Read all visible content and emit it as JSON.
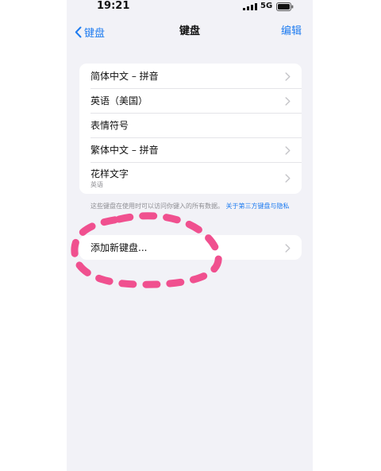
{
  "status_bar": {
    "time": "19:21",
    "network": "5G"
  },
  "nav": {
    "back_label": "键盘",
    "title": "键盘",
    "edit_label": "编辑"
  },
  "keyboards": [
    {
      "label": "简体中文 – 拼音"
    },
    {
      "label": "英语（美国）"
    },
    {
      "label": "表情符号"
    },
    {
      "label": "繁体中文 – 拼音"
    },
    {
      "label": "花样文字",
      "sub": "英语"
    }
  ],
  "footnote": {
    "text": "这些键盘在使用时可以访问你键入的所有数据。",
    "link": "关于第三方键盘与隐私"
  },
  "add_keyboard": {
    "label": "添加新键盘..."
  },
  "colors": {
    "accent": "#1f7cf0",
    "annotation": "#f0508f",
    "background": "#f2f2f7"
  }
}
